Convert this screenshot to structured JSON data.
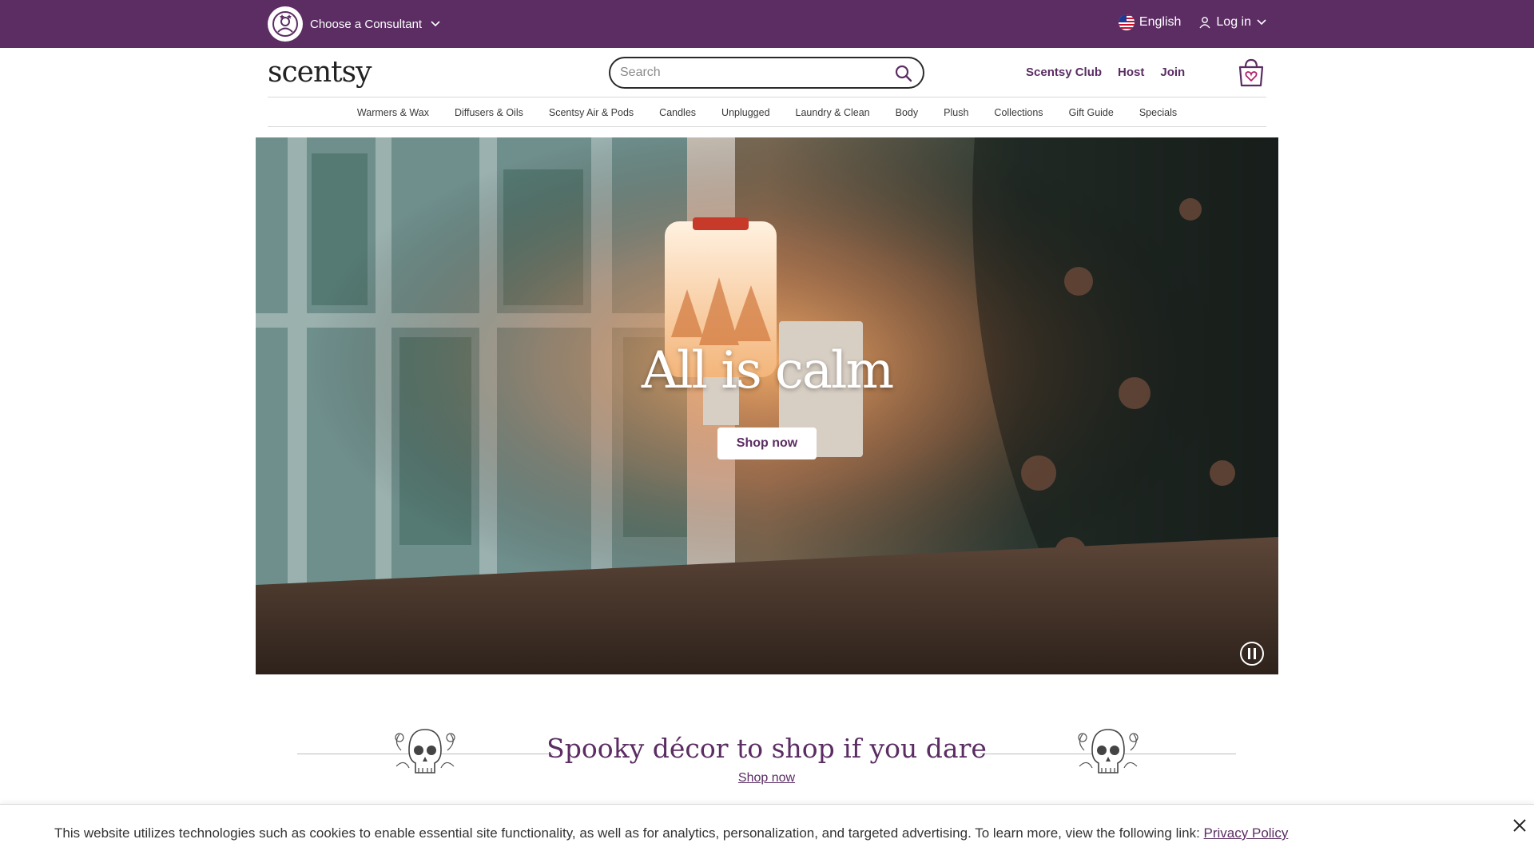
{
  "topbar": {
    "consultant_label": "Choose a Consultant",
    "language_label": "English",
    "login_label": "Log in"
  },
  "header": {
    "logo_text": "scentsy",
    "search_placeholder": "Search",
    "links": [
      "Scentsy Club",
      "Host",
      "Join"
    ]
  },
  "nav": {
    "items": [
      "Warmers & Wax",
      "Diffusers & Oils",
      "Scentsy Air & Pods",
      "Candles",
      "Unplugged",
      "Laundry & Clean",
      "Body",
      "Plush",
      "Collections",
      "Gift Guide",
      "Specials"
    ]
  },
  "hero": {
    "title": "All is calm",
    "button_label": "Shop now"
  },
  "promo": {
    "title": "Spooky décor to shop if you dare",
    "link_label": "Shop now"
  },
  "cookie": {
    "text": "This website utilizes technologies such as cookies to enable essential site functionality, as well as for analytics, personalization, and targeted advertising. To learn more, view the following link: ",
    "link_label": "Privacy Policy"
  },
  "colors": {
    "brand_purple": "#5b2d63",
    "white": "#ffffff"
  },
  "icons": [
    "consultant-avatar-icon",
    "chevron-down-icon",
    "us-flag-icon",
    "user-icon",
    "search-icon",
    "shopping-bag-heart-icon",
    "pause-icon",
    "skull-floral-icon",
    "close-icon"
  ]
}
